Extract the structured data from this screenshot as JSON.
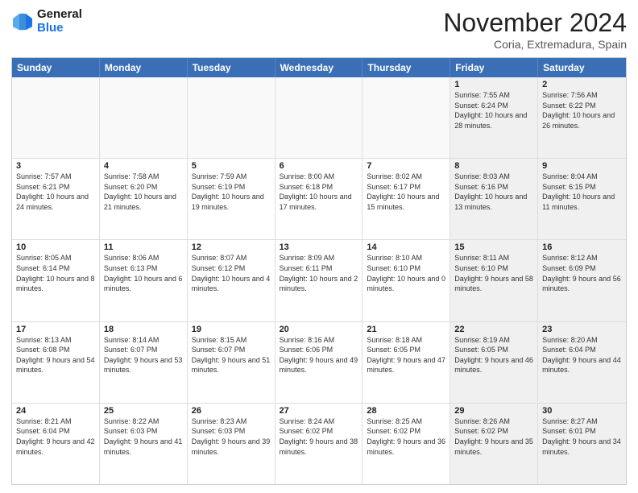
{
  "header": {
    "logo_line1": "General",
    "logo_line2": "Blue",
    "month": "November 2024",
    "location": "Coria, Extremadura, Spain"
  },
  "weekdays": [
    "Sunday",
    "Monday",
    "Tuesday",
    "Wednesday",
    "Thursday",
    "Friday",
    "Saturday"
  ],
  "rows": [
    [
      {
        "day": "",
        "text": "",
        "empty": true
      },
      {
        "day": "",
        "text": "",
        "empty": true
      },
      {
        "day": "",
        "text": "",
        "empty": true
      },
      {
        "day": "",
        "text": "",
        "empty": true
      },
      {
        "day": "",
        "text": "",
        "empty": true
      },
      {
        "day": "1",
        "text": "Sunrise: 7:55 AM\nSunset: 6:24 PM\nDaylight: 10 hours and 28 minutes.",
        "shaded": true
      },
      {
        "day": "2",
        "text": "Sunrise: 7:56 AM\nSunset: 6:22 PM\nDaylight: 10 hours and 26 minutes.",
        "shaded": true
      }
    ],
    [
      {
        "day": "3",
        "text": "Sunrise: 7:57 AM\nSunset: 6:21 PM\nDaylight: 10 hours and 24 minutes."
      },
      {
        "day": "4",
        "text": "Sunrise: 7:58 AM\nSunset: 6:20 PM\nDaylight: 10 hours and 21 minutes."
      },
      {
        "day": "5",
        "text": "Sunrise: 7:59 AM\nSunset: 6:19 PM\nDaylight: 10 hours and 19 minutes."
      },
      {
        "day": "6",
        "text": "Sunrise: 8:00 AM\nSunset: 6:18 PM\nDaylight: 10 hours and 17 minutes."
      },
      {
        "day": "7",
        "text": "Sunrise: 8:02 AM\nSunset: 6:17 PM\nDaylight: 10 hours and 15 minutes."
      },
      {
        "day": "8",
        "text": "Sunrise: 8:03 AM\nSunset: 6:16 PM\nDaylight: 10 hours and 13 minutes.",
        "shaded": true
      },
      {
        "day": "9",
        "text": "Sunrise: 8:04 AM\nSunset: 6:15 PM\nDaylight: 10 hours and 11 minutes.",
        "shaded": true
      }
    ],
    [
      {
        "day": "10",
        "text": "Sunrise: 8:05 AM\nSunset: 6:14 PM\nDaylight: 10 hours and 8 minutes."
      },
      {
        "day": "11",
        "text": "Sunrise: 8:06 AM\nSunset: 6:13 PM\nDaylight: 10 hours and 6 minutes."
      },
      {
        "day": "12",
        "text": "Sunrise: 8:07 AM\nSunset: 6:12 PM\nDaylight: 10 hours and 4 minutes."
      },
      {
        "day": "13",
        "text": "Sunrise: 8:09 AM\nSunset: 6:11 PM\nDaylight: 10 hours and 2 minutes."
      },
      {
        "day": "14",
        "text": "Sunrise: 8:10 AM\nSunset: 6:10 PM\nDaylight: 10 hours and 0 minutes."
      },
      {
        "day": "15",
        "text": "Sunrise: 8:11 AM\nSunset: 6:10 PM\nDaylight: 9 hours and 58 minutes.",
        "shaded": true
      },
      {
        "day": "16",
        "text": "Sunrise: 8:12 AM\nSunset: 6:09 PM\nDaylight: 9 hours and 56 minutes.",
        "shaded": true
      }
    ],
    [
      {
        "day": "17",
        "text": "Sunrise: 8:13 AM\nSunset: 6:08 PM\nDaylight: 9 hours and 54 minutes."
      },
      {
        "day": "18",
        "text": "Sunrise: 8:14 AM\nSunset: 6:07 PM\nDaylight: 9 hours and 53 minutes."
      },
      {
        "day": "19",
        "text": "Sunrise: 8:15 AM\nSunset: 6:07 PM\nDaylight: 9 hours and 51 minutes."
      },
      {
        "day": "20",
        "text": "Sunrise: 8:16 AM\nSunset: 6:06 PM\nDaylight: 9 hours and 49 minutes."
      },
      {
        "day": "21",
        "text": "Sunrise: 8:18 AM\nSunset: 6:05 PM\nDaylight: 9 hours and 47 minutes."
      },
      {
        "day": "22",
        "text": "Sunrise: 8:19 AM\nSunset: 6:05 PM\nDaylight: 9 hours and 46 minutes.",
        "shaded": true
      },
      {
        "day": "23",
        "text": "Sunrise: 8:20 AM\nSunset: 6:04 PM\nDaylight: 9 hours and 44 minutes.",
        "shaded": true
      }
    ],
    [
      {
        "day": "24",
        "text": "Sunrise: 8:21 AM\nSunset: 6:04 PM\nDaylight: 9 hours and 42 minutes."
      },
      {
        "day": "25",
        "text": "Sunrise: 8:22 AM\nSunset: 6:03 PM\nDaylight: 9 hours and 41 minutes."
      },
      {
        "day": "26",
        "text": "Sunrise: 8:23 AM\nSunset: 6:03 PM\nDaylight: 9 hours and 39 minutes."
      },
      {
        "day": "27",
        "text": "Sunrise: 8:24 AM\nSunset: 6:02 PM\nDaylight: 9 hours and 38 minutes."
      },
      {
        "day": "28",
        "text": "Sunrise: 8:25 AM\nSunset: 6:02 PM\nDaylight: 9 hours and 36 minutes."
      },
      {
        "day": "29",
        "text": "Sunrise: 8:26 AM\nSunset: 6:02 PM\nDaylight: 9 hours and 35 minutes.",
        "shaded": true
      },
      {
        "day": "30",
        "text": "Sunrise: 8:27 AM\nSunset: 6:01 PM\nDaylight: 9 hours and 34 minutes.",
        "shaded": true
      }
    ]
  ]
}
